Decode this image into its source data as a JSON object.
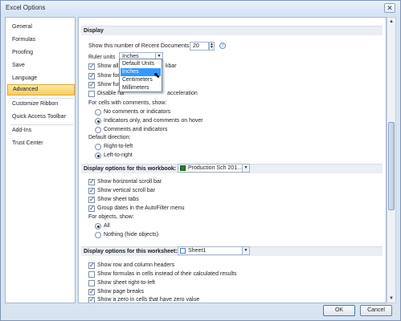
{
  "window": {
    "title": "Excel Options",
    "close_label": "✕"
  },
  "sidebar": {
    "items": [
      {
        "label": "General"
      },
      {
        "label": "Formulas"
      },
      {
        "label": "Proofing"
      },
      {
        "label": "Save"
      },
      {
        "label": "Language"
      },
      {
        "label": "Advanced",
        "active": true
      },
      {
        "label": "Customize Ribbon"
      },
      {
        "label": "Quick Access Toolbar"
      },
      {
        "label": "Add-Ins"
      },
      {
        "label": "Trust Center"
      }
    ]
  },
  "display": {
    "header": "Display",
    "recent_docs_label": "Show this number of Recent Documents:",
    "recent_docs_value": "20",
    "ruler_units_label": "Ruler units",
    "ruler_units_value": "Inches",
    "ruler_units_options": [
      "Default Units",
      "Inches",
      "Centimeters",
      "Millimeters"
    ],
    "ruler_units_highlighted": "Inches",
    "show_all_windows": "Show all",
    "show_all_windows_tail": "kbar",
    "show_formula_bar": "Show for",
    "show_function_tips": "Show fun",
    "disable_hw_accel": "Disable ha",
    "disable_hw_accel_tail": "acceleration",
    "comments_label": "For cells with comments, show:",
    "comments_options": [
      {
        "label": "No comments or indicators",
        "checked": false
      },
      {
        "label": "Indicators only, and comments on hover",
        "checked": true
      },
      {
        "label": "Comments and indicators",
        "checked": false
      }
    ],
    "direction_label": "Default direction:",
    "direction_options": [
      {
        "label": "Right-to-left",
        "checked": false
      },
      {
        "label": "Left-to-right",
        "checked": true
      }
    ]
  },
  "workbook": {
    "header": "Display options for this workbook:",
    "selected": "Production Sch 201...",
    "options": [
      {
        "label": "Show horizontal scroll bar",
        "checked": true
      },
      {
        "label": "Show vertical scroll bar",
        "checked": true
      },
      {
        "label": "Show sheet tabs",
        "checked": true
      },
      {
        "label": "Group dates in the AutoFilter menu",
        "checked": true
      }
    ],
    "objects_label": "For objects, show:",
    "objects_options": [
      {
        "label": "All",
        "checked": true
      },
      {
        "label": "Nothing (hide objects)",
        "checked": false
      }
    ]
  },
  "worksheet": {
    "header": "Display options for this worksheet:",
    "selected": "Sheet1",
    "options": [
      {
        "label": "Show row and column headers",
        "checked": true
      },
      {
        "label": "Show formulas in cells instead of their calculated results",
        "checked": false
      },
      {
        "label": "Show sheet right-to-left",
        "checked": false
      },
      {
        "label": "Show page breaks",
        "checked": true
      },
      {
        "label": "Show a zero in cells that have zero value",
        "checked": true
      }
    ]
  },
  "footer": {
    "ok_label": "OK",
    "cancel_label": "Cancel"
  },
  "colors": {
    "accent": "#f8cd5b",
    "highlight": "#3399ff",
    "frame": "#d9e4f1"
  }
}
